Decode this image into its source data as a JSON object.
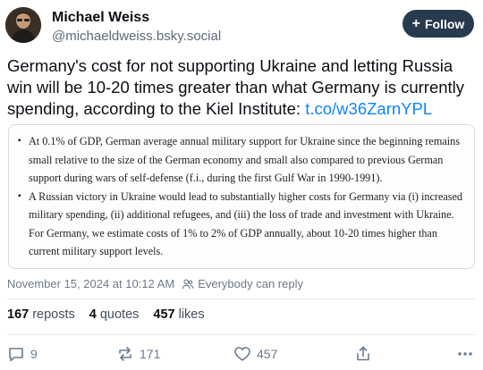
{
  "author": {
    "display_name": "Michael Weiss",
    "handle": "@michaeldweiss.bsky.social"
  },
  "follow": {
    "label": "Follow",
    "icon": "plus-icon"
  },
  "post": {
    "text": "Germany's cost for not supporting Ukraine and letting Russia win will be 10-20 times greater than what Germany is currently spending, according to the Kiel Institute: ",
    "link_text": "t.co/w36ZarnYPL",
    "link_color": "#1083fe"
  },
  "quote_image": {
    "bullets": [
      "At 0.1% of GDP, German average annual military support for Ukraine since the beginning remains small relative to the size of the German economy and small also compared to previous German support during wars of self-defense (f.i., during the first Gulf War in 1990-1991).",
      "A Russian victory in Ukraine would lead to substantially higher costs for Germany via (i) increased military spending, (ii) additional refugees, and (iii) the loss of trade and investment with Ukraine. For Germany, we estimate costs of 1% to 2% of GDP annually, about 10-20 times higher than current military support levels."
    ]
  },
  "meta": {
    "timestamp": "November 15, 2024 at 10:12 AM",
    "reply_setting": "Everybody can reply"
  },
  "stats": {
    "reposts_count": "167",
    "reposts_label": "reposts",
    "quotes_count": "4",
    "quotes_label": "quotes",
    "likes_count": "457",
    "likes_label": "likes"
  },
  "actions": {
    "reply_count": "9",
    "repost_count": "171",
    "like_count": "457"
  },
  "colors": {
    "follow_bg": "#283a4e",
    "link": "#1083fe",
    "muted": "#6b7b8c"
  }
}
